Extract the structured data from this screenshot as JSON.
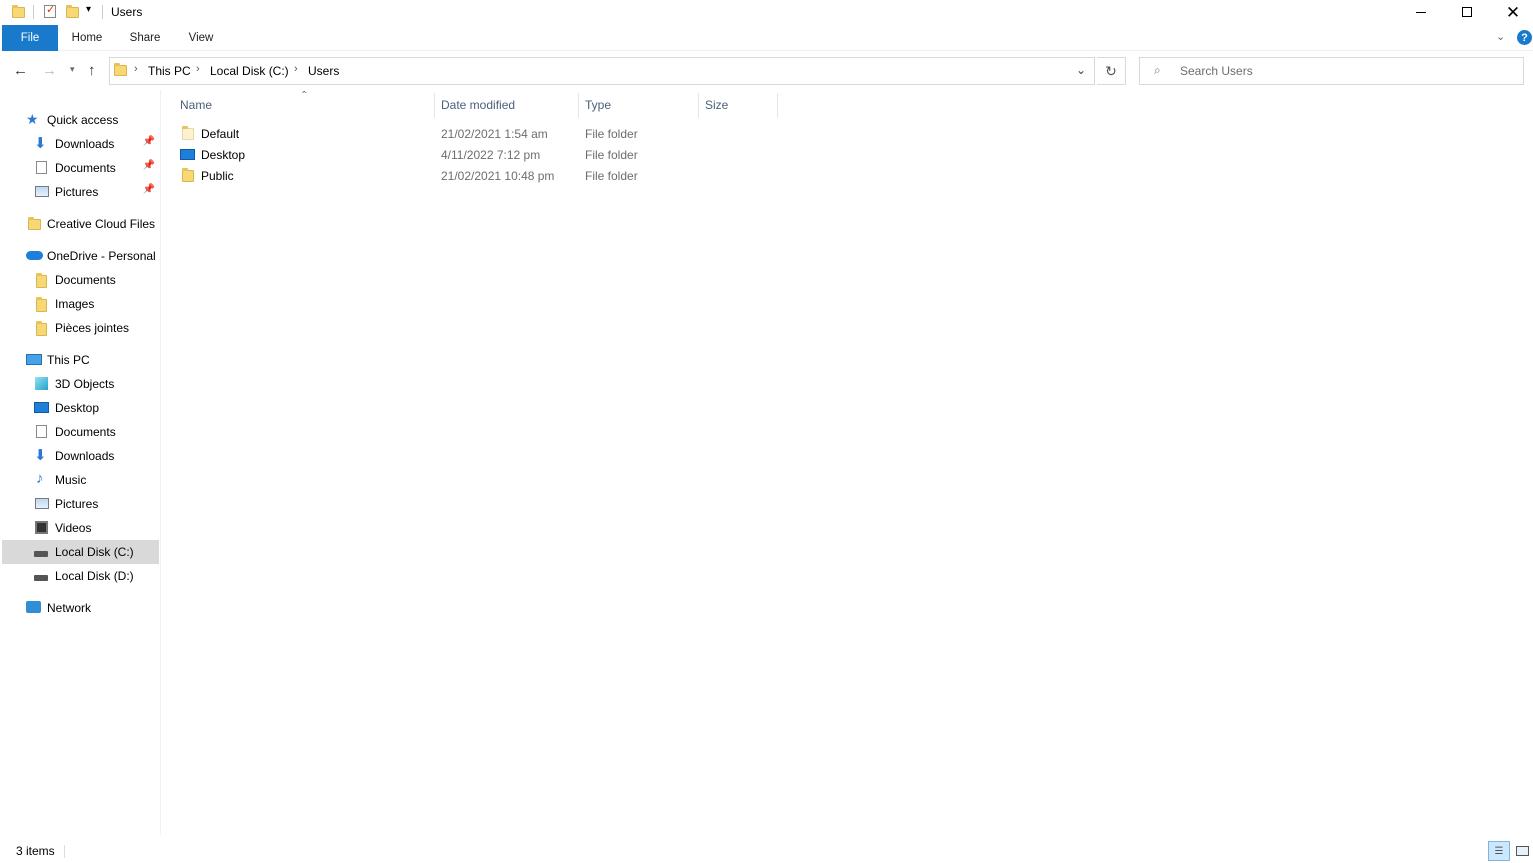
{
  "window": {
    "title": "Users",
    "minimize_icon": "minimize-icon",
    "maximize_icon": "maximize-icon",
    "close_icon": "close-icon"
  },
  "ribbon": {
    "tabs": [
      "File",
      "Home",
      "Share",
      "View"
    ],
    "help_label": "?"
  },
  "address": {
    "crumbs": [
      "This PC",
      "Local Disk (C:)",
      "Users"
    ],
    "search_placeholder": "Search Users"
  },
  "sidebar": {
    "quick_access": "Quick access",
    "quick_items": [
      "Downloads",
      "Documents",
      "Pictures"
    ],
    "creative_cloud": "Creative Cloud Files",
    "onedrive": "OneDrive - Personal",
    "onedrive_items": [
      "Documents",
      "Images",
      "Pièces jointes"
    ],
    "this_pc": "This PC",
    "pc_items": [
      "3D Objects",
      "Desktop",
      "Documents",
      "Downloads",
      "Music",
      "Pictures",
      "Videos",
      "Local Disk (C:)",
      "Local Disk (D:)"
    ],
    "network": "Network"
  },
  "columns": [
    "Name",
    "Date modified",
    "Type",
    "Size"
  ],
  "files": [
    {
      "name": "Default",
      "date": "21/02/2021 1:54 am",
      "type": "File folder",
      "size": ""
    },
    {
      "name": "Desktop",
      "date": "4/11/2022 7:12 pm",
      "type": "File folder",
      "size": ""
    },
    {
      "name": "Public",
      "date": "21/02/2021 10:48 pm",
      "type": "File folder",
      "size": ""
    }
  ],
  "status": {
    "count": "3 items"
  },
  "colors": {
    "accent": "#1979ca",
    "selected": "#d9d9d9",
    "folder": "#f8d775"
  }
}
